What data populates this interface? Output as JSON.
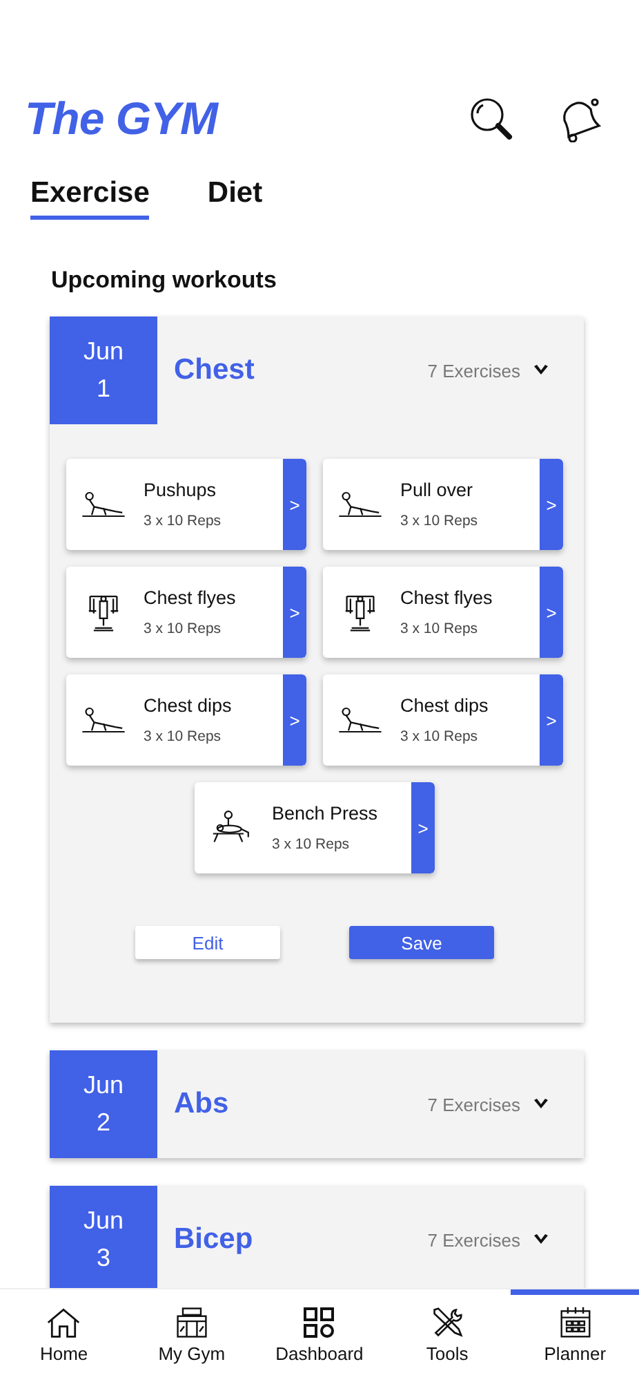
{
  "app": {
    "title": "The GYM"
  },
  "tabs": [
    {
      "label": "Exercise",
      "selected": true
    },
    {
      "label": "Diet",
      "selected": false
    }
  ],
  "section_title": "Upcoming workouts",
  "workouts": [
    {
      "month": "Jun",
      "day": "1",
      "name": "Chest",
      "count": "7 Exercises",
      "expanded": true,
      "exercises": [
        {
          "name": "Pushups",
          "sets": "3 x 10 Reps",
          "kind": "floor",
          "chevron": ">"
        },
        {
          "name": "Pull over",
          "sets": "3 x 10 Reps",
          "kind": "floor",
          "chevron": ">"
        },
        {
          "name": "Chest flyes",
          "sets": "3 x 10 Reps",
          "kind": "machine",
          "chevron": ">"
        },
        {
          "name": "Chest flyes",
          "sets": "3 x 10 Reps",
          "kind": "machine",
          "chevron": ">"
        },
        {
          "name": "Chest dips",
          "sets": "3 x 10 Reps",
          "kind": "floor",
          "chevron": ">"
        },
        {
          "name": "Chest dips",
          "sets": "3 x 10 Reps",
          "kind": "floor",
          "chevron": ">"
        },
        {
          "name": "Bench Press",
          "sets": "3 x 10 Reps",
          "kind": "bench",
          "chevron": ">"
        }
      ],
      "buttons": [
        "Edit",
        "Save"
      ]
    },
    {
      "month": "Jun",
      "day": "2",
      "name": "Abs",
      "count": "7 Exercises",
      "expanded": false
    },
    {
      "month": "Jun",
      "day": "3",
      "name": "Bicep",
      "count": "7 Exercises",
      "expanded": false
    }
  ],
  "nav": [
    {
      "label": "Home",
      "kind": "home",
      "selected": false
    },
    {
      "label": "My Gym",
      "kind": "gym",
      "selected": false
    },
    {
      "label": "Dashboard",
      "kind": "grid",
      "selected": false
    },
    {
      "label": "Tools",
      "kind": "tools",
      "selected": false
    },
    {
      "label": "Planner",
      "kind": "calendar",
      "selected": true
    }
  ]
}
